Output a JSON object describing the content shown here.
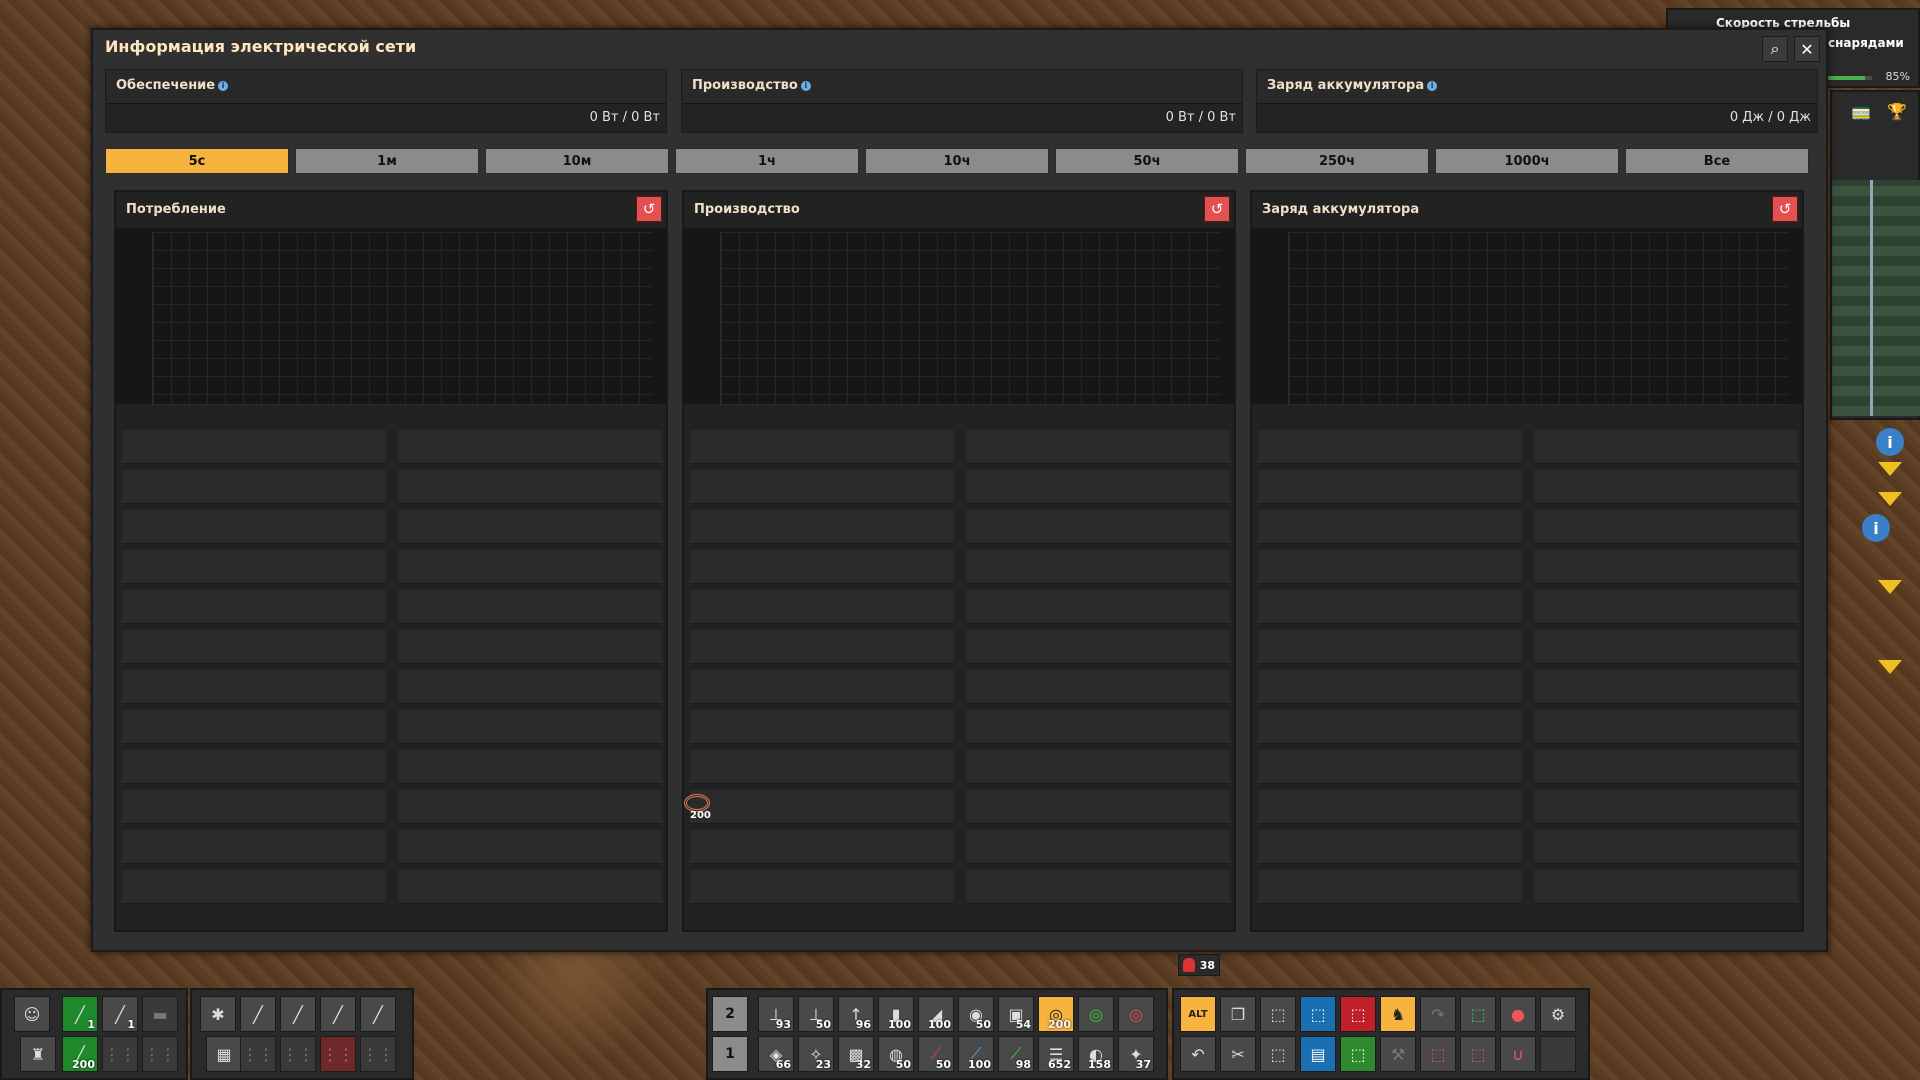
{
  "window": {
    "title": "Информация электрической сети"
  },
  "stats": [
    {
      "label": "Обеспечение",
      "value": "0 Вт / 0 Вт"
    },
    {
      "label": "Производство",
      "value": "0 Вт / 0 Вт"
    },
    {
      "label": "Заряд аккумулятора",
      "value": "0 Дж / 0 Дж"
    }
  ],
  "tabs": [
    "5с",
    "1м",
    "10м",
    "1ч",
    "10ч",
    "50ч",
    "250ч",
    "1000ч",
    "Все"
  ],
  "active_tab": "5с",
  "panels": [
    {
      "title": "Потребление"
    },
    {
      "title": "Производство"
    },
    {
      "title": "Заряд аккумулятора"
    }
  ],
  "floating_item": {
    "icon": "copper-cable-icon",
    "count": "200"
  },
  "hud_top_right": {
    "line1": "Скорость стрельбы",
    "line2": "снарядами",
    "percent": "85%"
  },
  "grenade_count": "38",
  "quickbar_left": {
    "slots_top": [
      {
        "icon": "character-icon",
        "count": ""
      },
      {
        "icon": "rifle-icon",
        "count": "1"
      },
      {
        "icon": "shotgun-icon",
        "count": "1"
      },
      {
        "icon": "pistol-icon",
        "count": ""
      }
    ],
    "slots_bottom": [
      {
        "icon": "armor-icon",
        "count": ""
      },
      {
        "icon": "ammo-icon",
        "count": "200"
      },
      {
        "icon": "empty-slot-icon",
        "count": ""
      },
      {
        "icon": "empty-slot-icon",
        "count": ""
      }
    ]
  },
  "quickbar_mid_left": {
    "slots_top": [
      {
        "icon": "spidertron-icon"
      },
      {
        "icon": "gun-icon"
      },
      {
        "icon": "gun-icon"
      },
      {
        "icon": "gun-icon"
      },
      {
        "icon": "gun-icon"
      }
    ],
    "slots_bottom": [
      {
        "icon": "grid-icon"
      },
      {
        "icon": "empty-slot-icon"
      },
      {
        "icon": "empty-slot-icon"
      },
      {
        "icon": "empty-slot-icon"
      },
      {
        "icon": "empty-slot-icon"
      }
    ]
  },
  "quickbar_main": {
    "row2_label": "2",
    "row1_label": "1",
    "row2": [
      {
        "icon": "big-pole-icon",
        "count": "93"
      },
      {
        "icon": "medium-pole-icon",
        "count": "50"
      },
      {
        "icon": "small-pole-icon",
        "count": "96"
      },
      {
        "icon": "pipe-icon",
        "count": "100"
      },
      {
        "icon": "pipe-to-ground-icon",
        "count": "100"
      },
      {
        "icon": "pump-icon",
        "count": "50"
      },
      {
        "icon": "circuit-icon",
        "count": "54"
      },
      {
        "icon": "copper-cable-icon",
        "count": "200"
      },
      {
        "icon": "green-wire-icon",
        "count": ""
      },
      {
        "icon": "red-wire-icon",
        "count": ""
      }
    ],
    "row1": [
      {
        "icon": "mining-drill-icon",
        "count": "66"
      },
      {
        "icon": "radar-icon",
        "count": "23"
      },
      {
        "icon": "roboport-icon",
        "count": "32"
      },
      {
        "icon": "solar-icon",
        "count": "50"
      },
      {
        "icon": "inserter-icon",
        "count": "50"
      },
      {
        "icon": "fast-inserter-icon",
        "count": "100"
      },
      {
        "icon": "long-inserter-icon",
        "count": "98"
      },
      {
        "icon": "rail-icon",
        "count": "652"
      },
      {
        "icon": "lamp-icon",
        "count": "158"
      },
      {
        "icon": "turret-icon",
        "count": "37"
      }
    ]
  },
  "shortcuts": {
    "row_top": [
      "alt-mode-icon",
      "copy-icon",
      "select-icon",
      "blueprint-select-icon",
      "deconstruct-icon",
      "toggle-personal-icon",
      "undo-arc-icon",
      "upgrade-icon",
      "tip-icon",
      "planner-icon"
    ],
    "row_bottom": [
      "undo-icon",
      "cut-icon",
      "paste-icon",
      "blueprint-book-icon",
      "green-select-icon",
      "wrench-icon",
      "red-select-icon",
      "red-select-icon",
      "magnet-icon",
      "empty-slot-icon"
    ]
  },
  "colors": {
    "accent": "#f7b33e",
    "reset_button": "#e25050",
    "window_bg": "#313031"
  }
}
